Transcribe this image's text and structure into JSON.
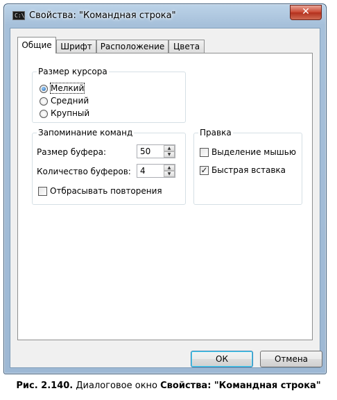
{
  "window": {
    "title": "Свойства: \"Командная строка\"",
    "icon_text": "C:\\",
    "close_label": "✕"
  },
  "tabs": [
    {
      "label": "Общие",
      "active": true
    },
    {
      "label": "Шрифт",
      "active": false
    },
    {
      "label": "Расположение",
      "active": false
    },
    {
      "label": "Цвета",
      "active": false
    }
  ],
  "cursor_size": {
    "title": "Размер курсора",
    "options": [
      {
        "label": "Мелкий",
        "checked": true
      },
      {
        "label": "Средний",
        "checked": false
      },
      {
        "label": "Крупный",
        "checked": false
      }
    ]
  },
  "command_history": {
    "title": "Запоминание команд",
    "buffer_size_label": "Размер буфера:",
    "buffer_size_value": "50",
    "buffer_count_label": "Количество буферов:",
    "buffer_count_value": "4",
    "discard_duplicates_label": "Отбрасывать повторения",
    "discard_duplicates_checked": false
  },
  "edit_options": {
    "title": "Правка",
    "quick_edit_label": "Выделение мышью",
    "quick_edit_checked": false,
    "insert_mode_label": "Быстрая вставка",
    "insert_mode_checked": true
  },
  "buttons": {
    "ok_label": "ОК",
    "cancel_label": "Отмена"
  },
  "caption": {
    "prefix": "Рис. 2.140.",
    "middle": " Диалоговое окно ",
    "bold_name": "Свойства: \"Командная строка\""
  }
}
